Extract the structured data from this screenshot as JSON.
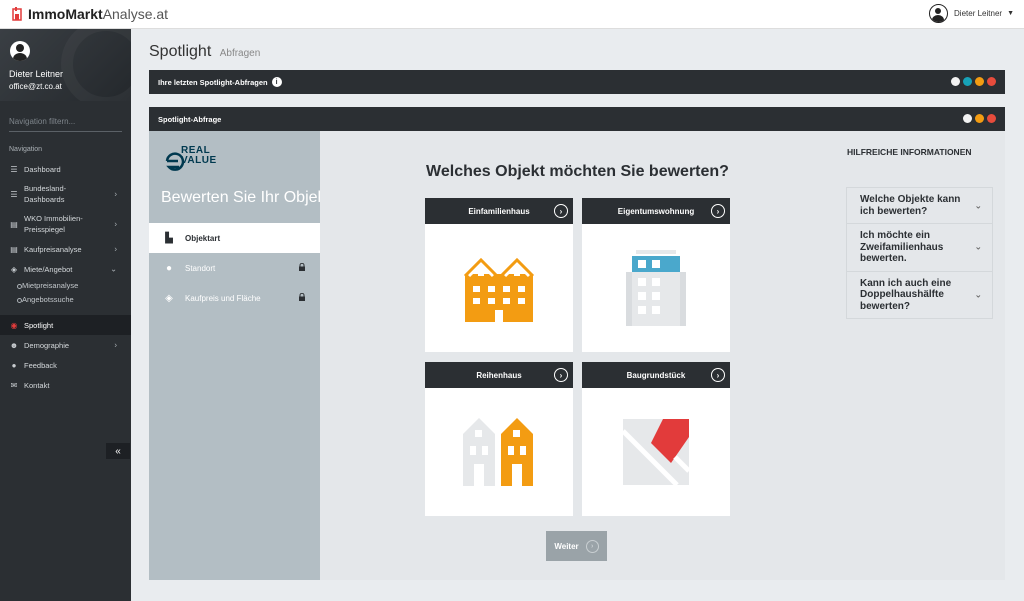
{
  "app": {
    "logo_bold": "ImmoMarkt",
    "logo_light": "Analyse.at"
  },
  "user_menu": {
    "name": "Dieter Leitner"
  },
  "sidebar": {
    "profile": {
      "name": "Dieter Leitner",
      "email": "office@zt.co.at"
    },
    "filter_placeholder": "Navigation filtern...",
    "heading": "Navigation",
    "items": [
      {
        "label": "Dashboard",
        "icon": "dashboard-icon"
      },
      {
        "label": "Bundesland-Dashboards",
        "icon": "dashboard-icon",
        "chevron": ">"
      },
      {
        "label": "WKO Immobilien-Preisspiegel",
        "icon": "chart-icon",
        "chevron": ">"
      },
      {
        "label": "Kaufpreisanalyse",
        "icon": "chart-icon",
        "chevron": ">"
      },
      {
        "label": "Miete/Angebot",
        "icon": "layers-icon",
        "chevron": "v"
      },
      {
        "label": "Spotlight",
        "icon": "spotlight-icon"
      },
      {
        "label": "Demographie",
        "icon": "users-icon",
        "chevron": ">"
      },
      {
        "label": "Feedback",
        "icon": "comment-icon"
      },
      {
        "label": "Kontakt",
        "icon": "mail-icon"
      }
    ],
    "sub_items": [
      "Mietpreisanalyse",
      "Angebotssuche"
    ],
    "collapse_label": "«"
  },
  "page": {
    "title": "Spotlight",
    "subtitle": "Abfragen"
  },
  "panels": {
    "recent": {
      "title": "Ihre letzten Spotlight-Abfragen",
      "info": "i"
    },
    "query": {
      "title": "Spotlight-Abfrage"
    }
  },
  "steps": {
    "logo_line1": "REAL",
    "logo_line2": "VALUE",
    "title": "Bewerten Sie Ihr Objekt",
    "items": [
      {
        "label": "Objektart",
        "locked": false
      },
      {
        "label": "Standort",
        "locked": true
      },
      {
        "label": "Kaufpreis und Fläche",
        "locked": true
      }
    ]
  },
  "wizard": {
    "question": "Welches Objekt möchten Sie bewerten?",
    "objects": [
      {
        "label": "Einfamilienhaus",
        "icon": "house-icon"
      },
      {
        "label": "Eigentumswohnung",
        "icon": "apartment-icon"
      },
      {
        "label": "Reihenhaus",
        "icon": "terraced-house-icon"
      },
      {
        "label": "Baugrundstück",
        "icon": "plot-icon"
      }
    ],
    "next_label": "Weiter",
    "arrow": "›"
  },
  "help": {
    "title": "HILFREICHE INFORMATIONEN",
    "faqs": [
      "Welche Objekte kann ich bewerten?",
      "Ich möchte ein Zweifamilienhaus bewerten.",
      "Kann ich auch eine Doppelhaushälfte bewerten?"
    ]
  },
  "colors": {
    "accent_orange": "#f39c12",
    "dark": "#2b2f33",
    "active_red": "#e23b3b",
    "teal": "#17a2b8"
  }
}
